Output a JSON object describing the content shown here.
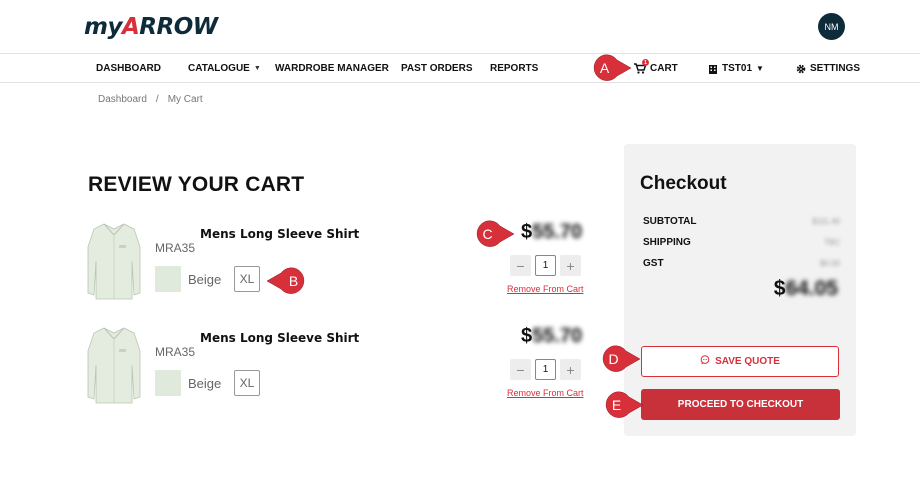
{
  "header": {
    "logo_prefix": "my",
    "logo_a": "A",
    "logo_suffix": "RROW",
    "avatar_initials": "NM"
  },
  "nav": {
    "dashboard": "DASHBOARD",
    "catalogue": "CATALOGUE",
    "wardrobe": "WARDROBE MANAGER",
    "past_orders": "PAST ORDERS",
    "reports": "REPORTS",
    "cart": "CART",
    "cart_count": "1",
    "store": "TST01",
    "settings": "SETTINGS"
  },
  "breadcrumb": {
    "home": "Dashboard",
    "sep": "/",
    "current": "My Cart"
  },
  "page_title": "REVIEW YOUR CART",
  "cart_items": [
    {
      "name": "Mens Long Sleeve Shirt",
      "sku": "MRA35",
      "color": "Beige",
      "size": "XL",
      "currency": "$",
      "price_hidden": "55.70",
      "qty": "1",
      "minus": "−",
      "plus": "+",
      "remove": "Remove From Cart"
    },
    {
      "name": "Mens Long Sleeve Shirt",
      "sku": "MRA35",
      "color": "Beige",
      "size": "XL",
      "currency": "$",
      "price_hidden": "55.70",
      "qty": "1",
      "minus": "−",
      "plus": "+",
      "remove": "Remove From Cart"
    }
  ],
  "checkout": {
    "title": "Checkout",
    "subtotal_label": "SUBTOTAL",
    "subtotal_value": "$111.40",
    "shipping_label": "SHIPPING",
    "shipping_value": "TBC",
    "gst_label": "GST",
    "gst_value": "$0.00",
    "total_currency": "$",
    "total_hidden": "64.05",
    "save_quote": "SAVE QUOTE",
    "proceed": "PROCEED TO CHECKOUT"
  },
  "callouts": {
    "a": "A",
    "b": "B",
    "c": "C",
    "d": "D",
    "e": "E"
  },
  "colors": {
    "accent": "#d7303b",
    "brand_dark": "#0e2b3a",
    "panel": "#f2f2f2"
  },
  "icons": [
    "cart-icon",
    "building-icon",
    "gear-icon",
    "chat-bubble-icon",
    "chevron-down-icon",
    "shirt-image"
  ]
}
